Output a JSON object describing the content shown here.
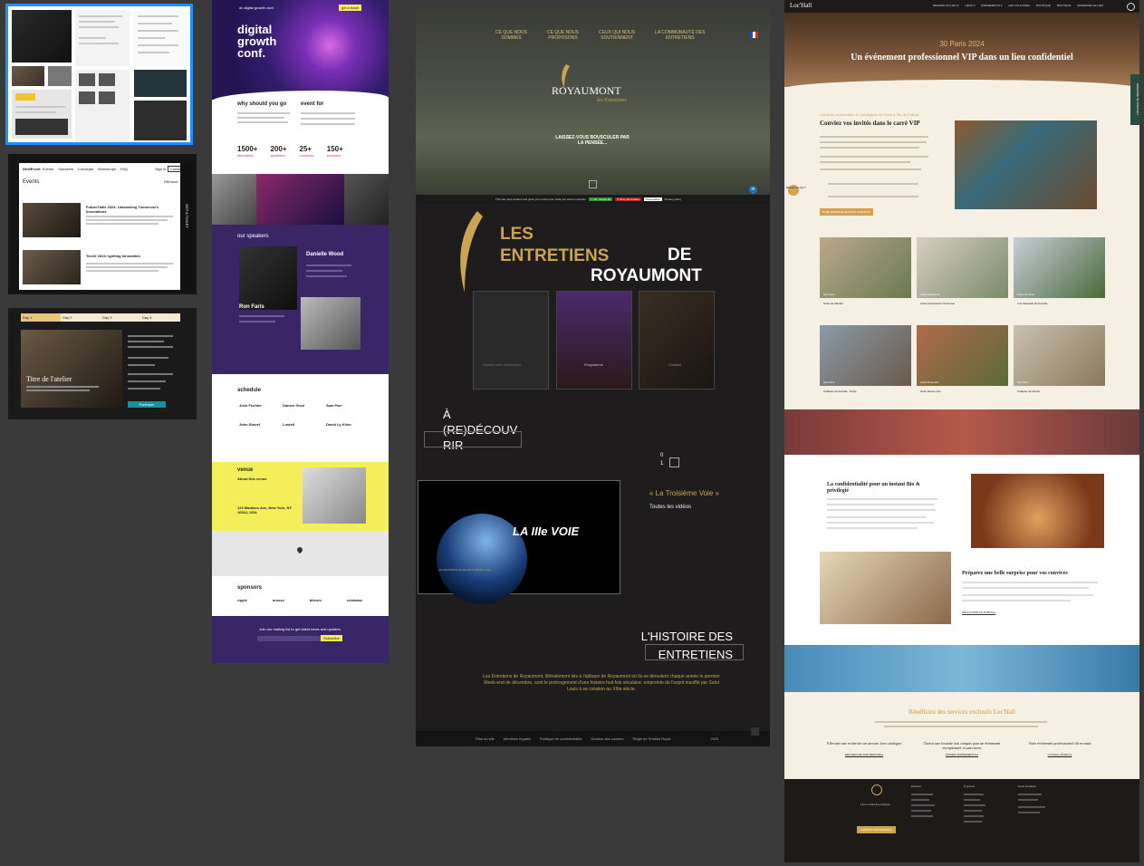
{
  "thumbs": {
    "events_nav": [
      "Events",
      "Speakers",
      "Concepts",
      "Workshops",
      "FAQ"
    ],
    "events_sign": [
      "Sign in",
      "Contact"
    ],
    "events_title": "Events",
    "events_filter": "Filtrosort",
    "event1": "FutureTalks 2024: Unleashing Tomorrow's Innovations",
    "event2": "TechX 2024: Igniting Innovation",
    "side_label": "GET A TICKET",
    "workshop_days": [
      "Day 1",
      "Day 2",
      "Day 3",
      "Day 4"
    ],
    "workshop_title": "Titre de l'atelier",
    "workshop_btn": "Participer"
  },
  "conf": {
    "logo": "dc digital growth conf.",
    "nav_btn": "get a ticket",
    "hero": [
      "digital",
      "growth",
      "conf."
    ],
    "why": "why should you go",
    "event_for": "event for",
    "stats": [
      {
        "value": "1500+",
        "label": "attendees"
      },
      {
        "value": "200+",
        "label": "speakers"
      },
      {
        "value": "25+",
        "label": "countries"
      },
      {
        "value": "150+",
        "label": "sessions"
      }
    ],
    "speakers_title": "our speakers",
    "speaker1": "Danielle Wood",
    "speaker2": "Ron Faris",
    "schedule_title": "schedule",
    "schedule_names": [
      "Josh Fechter",
      "Damen Grod",
      "Sam Parr",
      "John Stonef",
      "Lustefi",
      "David Ly Khim"
    ],
    "venue_title": "venue",
    "venue_sub": "About this venue",
    "venue_addr": "123 Madison Ave, New York, NY 10022, USA",
    "sponsors_title": "sponsors",
    "sponsors": [
      "ripple",
      "monzo",
      "bitcoin",
      "coinbase"
    ],
    "mailing": "Join our mailing list to get latest news and updates.",
    "subscribe": "Subscribe"
  },
  "roy": {
    "nav": [
      [
        "CE QUE NOUS",
        "SOMMES"
      ],
      [
        "CE QUE NOUS",
        "PROPOSONS"
      ],
      [
        "CEUX QUI NOUS",
        "SOUTIENNENT"
      ],
      [
        "LA COMMUNAUTÉ DES",
        "ENTRETIENS"
      ]
    ],
    "logo": "ROYAUMONT",
    "logo_sub": "les Entretiens",
    "tagline": [
      "LAISSEZ-VOUS BOUSCULER PAR",
      "LA PENSÉE..."
    ],
    "cookie": "This site uses cookies and gives you control over what you want to activate",
    "cookie_btns": [
      "✓ OK, accept all",
      "✕ Deny all cookies",
      "Personalize",
      "Privacy policy"
    ],
    "big_title": [
      "LES",
      "ENTRETIENS",
      "DE",
      "ROYAUMONT"
    ],
    "cards": [
      "Gestion des recherches",
      "Programme",
      "Contact"
    ],
    "rediscover": [
      "À",
      "(RE)DÉCOUV",
      "RIR"
    ],
    "video_title": "LA IIIe VOIE",
    "video_sub": "LES ENTRETIENS DE ROYAUMONT 2022",
    "count": [
      "0",
      "1"
    ],
    "third_way": "« La Troisième Voie »",
    "all_videos": "Toutes les vidéos",
    "history": [
      "L'HISTOIRE DES",
      "ENTRETIENS"
    ],
    "history_text": "Les Entretiens de Royaumont, littéralement liés à l'abbaye de Royaumont où ils se déroulent chaque année le premier Week-end de décembre, sont le prolongement d'une histoire huit fois séculaire, empreinte de l'esprit insufflé par Saint Louis à sa création au XIIIe siècle.",
    "footer": [
      "Plan du site",
      "Mentions légales",
      "Politique de confidentialité",
      "Gestion des cookies",
      "Règle de l'Institut Royal"
    ],
    "footer_year": "2025"
  },
  "loc": {
    "logo": "Loc'Hall",
    "nav": [
      "DEVENIR UN LIEU ▾",
      "LIEUX ▾",
      "ÉVÉNEMENTS ▾",
      "LES COULISSES",
      "BOUTIQUE",
      "BOUTIQUE",
      "RESERVEZ CE LIEU"
    ],
    "date": "30 Paris 2024",
    "hero": "Un événement professionnel VIP dans un lieu confidentiel",
    "kicker": "Les lieux confidentiels et prestigieux de Paris à l'Île-de-France",
    "h2": "Conviez vos invités dans le carré VIP",
    "cta": "ÊTRE RAPPELÉ DE PARIS (GRATUIT)",
    "contact_bubble": "Besoin conseil ?",
    "venues": [
      {
        "tag": "Sur Paris",
        "name": "Hôtel de Mardier"
      },
      {
        "tag": "Label Exploitant",
        "name": "Hôtel Ambassade Cantonale"
      },
      {
        "tag": "Lieux de Paris",
        "name": "L'Ambassade Normandie"
      },
      {
        "tag": "Sur Paris",
        "name": "Château d'Usanville, Trinité"
      },
      {
        "tag": "Label Rupestre",
        "name": "Hôtel Musée Arte"
      },
      {
        "tag": "Sur Paris",
        "name": "Château de Moulin"
      }
    ],
    "s2_title": "La confidentialité pour un instant Bio & privilégié",
    "s3_title": "Préparez une belle surprise pour vos convives",
    "s3_btn": "DÉCOUVRIR PLUS BIOS ▸",
    "services_title": "Bénéficiez des services exclusifs Loc'Hall",
    "services": [
      {
        "title": "Effectuer une recherche sur mesure, hors catalogue",
        "link": "RECHERCHE SUR MESURE ▸"
      },
      {
        "title": "Choisir une formule tout compris pour un événement exceptionnel, et sans stress",
        "link": "OFFRES ÉVÉNEMENTS ▸"
      },
      {
        "title": "Votre événement professionnel clé en main",
        "link": "LOCHALL ÉVENT ▸"
      }
    ],
    "footer_brand": "Lieux cachés & prestigieux",
    "footer_btn": "COMPTE PARTENAIRES",
    "footer_cols": [
      "Explorer",
      "À propos",
      "Nous contacter"
    ],
    "side_tab": "DEMANDE DE CONTACT"
  },
  "colors": {
    "selection": "#1e90ff",
    "conf_purple": "#3a2667",
    "conf_yellow": "#f4ee5a",
    "roy_gold": "#c9a552",
    "loc_gold": "#d4a24c",
    "loc_cream": "#f6efe4"
  }
}
